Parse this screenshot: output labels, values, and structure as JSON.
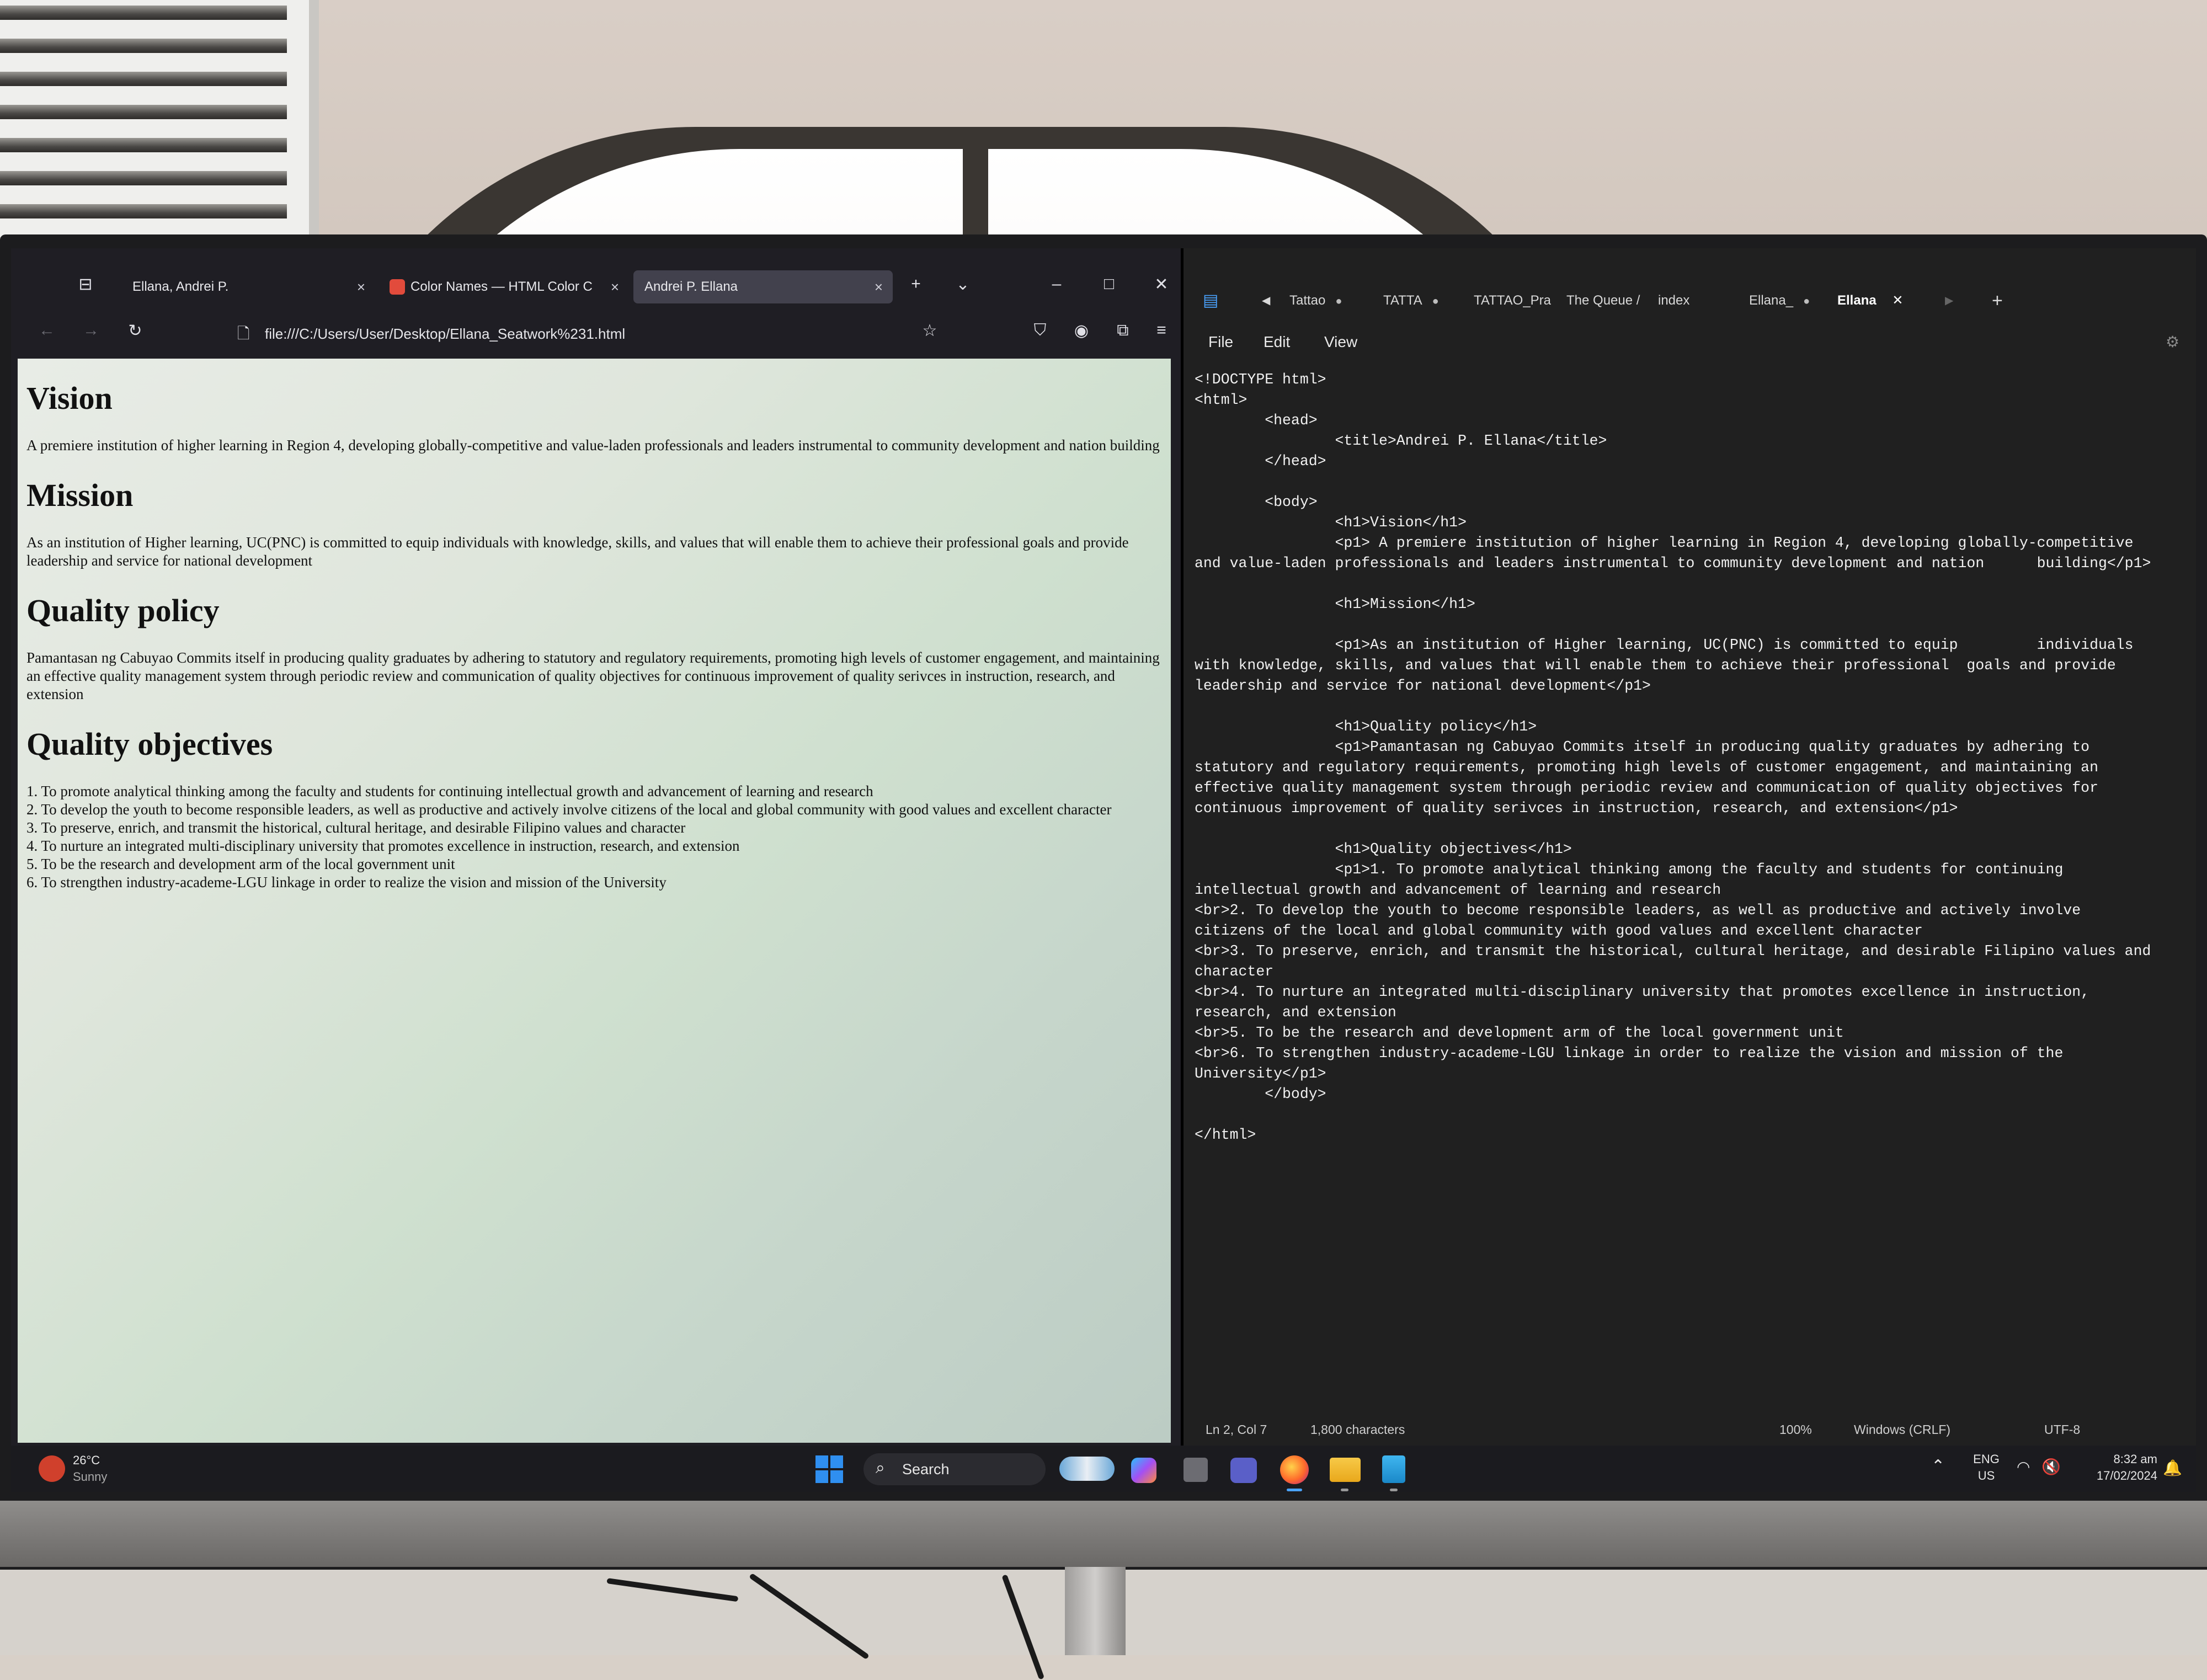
{
  "browser": {
    "tabs": [
      {
        "label": "Ellana, Andrei P."
      },
      {
        "label": "Color Names — HTML Color C"
      },
      {
        "label": "Andrei P. Ellana"
      }
    ],
    "url": "file:///C:/Users/User/Desktop/Ellana_Seatwork%231.html",
    "page": {
      "vision_title": "Vision",
      "vision_text": "A premiere institution of higher learning in Region 4, developing globally-competitive and value-laden professionals and leaders instrumental to community development and nation building",
      "mission_title": "Mission",
      "mission_text": "As an institution of Higher learning, UC(PNC) is committed to equip individuals with knowledge, skills, and values that will enable them to achieve their professional goals and provide leadership and service for national development",
      "policy_title": "Quality policy",
      "policy_text": "Pamantasan ng Cabuyao Commits itself in producing quality graduates by adhering to statutory and regulatory requirements, promoting high levels of customer engagement, and maintaining an effective quality management system through periodic review and communication of quality objectives for continuous improvement of quality serivces in instruction, research, and extension",
      "objectives_title": "Quality objectives",
      "objectives": [
        "1. To promote analytical thinking among the faculty and students for continuing intellectual growth and advancement of learning and research",
        "2. To develop the youth to become responsible leaders, as well as productive and actively involve citizens of the local and global community with good values and excellent character",
        "3. To preserve, enrich, and transmit the historical, cultural heritage, and desirable Filipino values and character",
        "4. To nurture an integrated multi-disciplinary university that promotes excellence in instruction, research, and extension",
        "5. To be the research and development arm of the local government unit",
        "6. To strengthen industry-academe-LGU linkage in order to realize the vision and mission of the University"
      ]
    }
  },
  "notepad": {
    "tabs": [
      {
        "label": "Tattao",
        "modified": "●"
      },
      {
        "label": "TATTA",
        "modified": "●"
      },
      {
        "label": "TATTAO_Pra"
      },
      {
        "label": "The Queue /"
      },
      {
        "label": "index"
      },
      {
        "label": "Ellana_",
        "modified": "●"
      },
      {
        "label": "Ellana"
      }
    ],
    "menu": {
      "file": "File",
      "edit": "Edit",
      "view": "View"
    },
    "code": "<!DOCTYPE html>\n<html>\n        <head>\n                <title>Andrei P. Ellana</title>\n        </head>\n\n        <body>\n                <h1>Vision</h1>\n                <p1> A premiere institution of higher learning in Region 4, developing globally-competitive\nand value-laden professionals and leaders instrumental to community development and nation      building</p1>\n\n                <h1>Mission</h1>\n\n                <p1>As an institution of Higher learning, UC(PNC) is committed to equip         individuals\nwith knowledge, skills, and values that will enable them to achieve their professional  goals and provide\nleadership and service for national development</p1>\n\n                <h1>Quality policy</h1>\n                <p1>Pamantasan ng Cabuyao Commits itself in producing quality graduates by adhering to\nstatutory and regulatory requirements, promoting high levels of customer engagement, and maintaining an\neffective quality management system through periodic review and communication of quality objectives for\ncontinuous improvement of quality serivces in instruction, research, and extension</p1>\n\n                <h1>Quality objectives</h1>\n                <p1>1. To promote analytical thinking among the faculty and students for continuing\nintellectual growth and advancement of learning and research\n<br>2. To develop the youth to become responsible leaders, as well as productive and actively involve\ncitizens of the local and global community with good values and excellent character\n<br>3. To preserve, enrich, and transmit the historical, cultural heritage, and desirable Filipino values and\ncharacter\n<br>4. To nurture an integrated multi-disciplinary university that promotes excellence in instruction,\nresearch, and extension\n<br>5. To be the research and development arm of the local government unit\n<br>6. To strengthen industry-academe-LGU linkage in order to realize the vision and mission of the\nUniversity</p1>\n        </body>\n\n</html>",
    "status": {
      "position": "Ln 2, Col 7",
      "chars": "1,800 characters",
      "zoom": "100%",
      "line_ending": "Windows (CRLF)",
      "encoding": "UTF-8"
    }
  },
  "taskbar": {
    "weather_temp": "26°C",
    "weather_desc": "Sunny",
    "search_label": "Search",
    "lang": "ENG",
    "region": "US",
    "time": "8:32 am",
    "date": "17/02/2024"
  }
}
